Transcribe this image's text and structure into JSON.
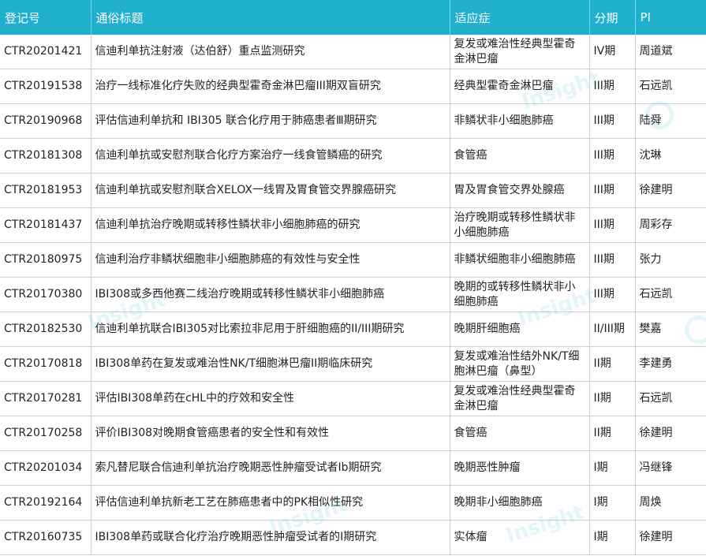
{
  "table": {
    "headers": {
      "id": "登记号",
      "title": "通俗标题",
      "indication": "适应症",
      "phase": "分期",
      "pi": "PI"
    },
    "rows": [
      {
        "id": "CTR20201421",
        "title": "信迪利单抗注射液（达伯舒）重点监测研究",
        "indication": "复发或难治性经典型霍奇金淋巴瘤",
        "phase": "IV期",
        "pi": "周道斌"
      },
      {
        "id": "CTR20191538",
        "title": "治疗一线标准化疗失败的经典型霍奇金淋巴瘤III期双盲研究",
        "indication": "经典型霍奇金淋巴瘤",
        "phase": "III期",
        "pi": "石远凯"
      },
      {
        "id": "CTR20190968",
        "title": "评估信迪利单抗和 IBI305 联合化疗用于肺癌患者Ⅲ期研究",
        "indication": "非鳞状非小细胞肺癌",
        "phase": "III期",
        "pi": "陆舜"
      },
      {
        "id": "CTR20181308",
        "title": "信迪利单抗或安慰剂联合化疗方案治疗一线食管鳞癌的研究",
        "indication": "食管癌",
        "phase": "III期",
        "pi": "沈琳"
      },
      {
        "id": "CTR20181953",
        "title": "信迪利单抗或安慰剂联合XELOX一线胃及胃食管交界腺癌研究",
        "indication": "胃及胃食管交界处腺癌",
        "phase": "III期",
        "pi": "徐建明"
      },
      {
        "id": "CTR20181437",
        "title": "信迪利单抗治疗晚期或转移性鳞状非小细胞肺癌的研究",
        "indication": "治疗晚期或转移性鳞状非小细胞肺癌",
        "phase": "III期",
        "pi": "周彩存"
      },
      {
        "id": "CTR20180975",
        "title": "信迪利治疗非鳞状细胞非小细胞肺癌的有效性与安全性",
        "indication": "非鳞状细胞非小细胞肺癌",
        "phase": "III期",
        "pi": "张力"
      },
      {
        "id": "CTR20170380",
        "title": "IBI308或多西他赛二线治疗晚期或转移性鳞状非小细胞肺癌",
        "indication": "晚期的或转移性鳞状非小细胞肺癌",
        "phase": "III期",
        "pi": "石远凯"
      },
      {
        "id": "CTR20182530",
        "title": "信迪利单抗联合IBI305对比索拉非尼用于肝细胞癌的II/III期研究",
        "indication": "晚期肝细胞癌",
        "phase": "II/III期",
        "pi": "樊嘉"
      },
      {
        "id": "CTR20170818",
        "title": "IBI308单药在复发或难治性NK/T细胞淋巴瘤II期临床研究",
        "indication": "复发或难治性结外NK/T细胞淋巴瘤（鼻型）",
        "phase": "II期",
        "pi": "李建勇"
      },
      {
        "id": "CTR20170281",
        "title": "评估IBI308单药在cHL中的疗效和安全性",
        "indication": "复发或难治性经典型霍奇金淋巴瘤",
        "phase": "II期",
        "pi": "石远凯"
      },
      {
        "id": "CTR20170258",
        "title": "评价IBI308对晚期食管癌患者的安全性和有效性",
        "indication": "食管癌",
        "phase": "II期",
        "pi": "徐建明"
      },
      {
        "id": "CTR20201034",
        "title": "索凡替尼联合信迪利单抗治疗晚期恶性肿瘤受试者Ib期研究",
        "indication": "晚期恶性肿瘤",
        "phase": "I期",
        "pi": "冯继锋"
      },
      {
        "id": "CTR20192164",
        "title": "评估信迪利单抗新老工艺在肺癌患者中的PK相似性研究",
        "indication": "晚期非小细胞肺癌",
        "phase": "I期",
        "pi": "周焕"
      },
      {
        "id": "CTR20160735",
        "title": "IBI308单药或联合化疗治疗晚期恶性肿瘤受试者的I期研究",
        "indication": "实体瘤",
        "phase": "I期",
        "pi": "徐建明"
      }
    ]
  },
  "watermark": {
    "text": "Insight",
    "color": "#1fb0cf"
  },
  "colors": {
    "header_bg": "#1fb0cf",
    "header_text": "#ffffff",
    "grid": "#cfcfcf"
  }
}
